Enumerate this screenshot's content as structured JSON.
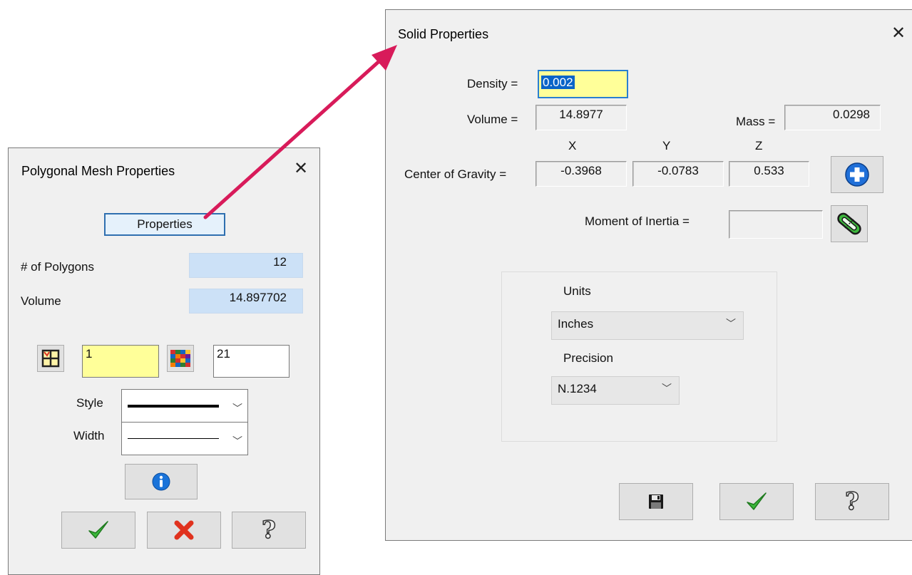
{
  "left_dialog": {
    "title": "Polygonal Mesh Properties",
    "close_glyph": "✕",
    "properties_button": "Properties",
    "polygons_label": "# of Polygons",
    "polygons_value": "12",
    "volume_label": "Volume",
    "volume_value": "14.897702",
    "layer_value": "1",
    "color_value": "21",
    "style_label": "Style",
    "width_label": "Width",
    "icons": {
      "layer": "layer-grid-icon",
      "color": "color-palette-icon",
      "info": "info-icon",
      "ok": "green-checkmark-icon",
      "cancel": "red-x-icon",
      "help": "question-mark-icon"
    }
  },
  "right_dialog": {
    "title": "Solid Properties",
    "close_glyph": "✕",
    "density_label": "Density =",
    "density_value": "0.002",
    "volume_label": "Volume =",
    "volume_value": "14.8977",
    "mass_label": "Mass =",
    "mass_value": "0.0298",
    "axis_x": "X",
    "axis_y": "Y",
    "axis_z": "Z",
    "cog_label": "Center of Gravity =",
    "cog_x": "-0.3968",
    "cog_y": "-0.0783",
    "cog_z": "0.533",
    "moi_label": "Moment of Inertia =",
    "moi_value": "",
    "units_label": "Units",
    "units_value": "Inches",
    "precision_label": "Precision",
    "precision_value": "N.1234",
    "icons": {
      "add": "blue-plus-icon",
      "inertia": "green-link-icon",
      "save": "floppy-disk-icon",
      "ok": "green-checkmark-icon",
      "help": "question-mark-icon"
    }
  },
  "colors": {
    "arrow": "#d81b5a",
    "highlight_blue": "#cce1f7",
    "yellow_field": "#ffff99",
    "focus_border": "#2f6fb0"
  }
}
